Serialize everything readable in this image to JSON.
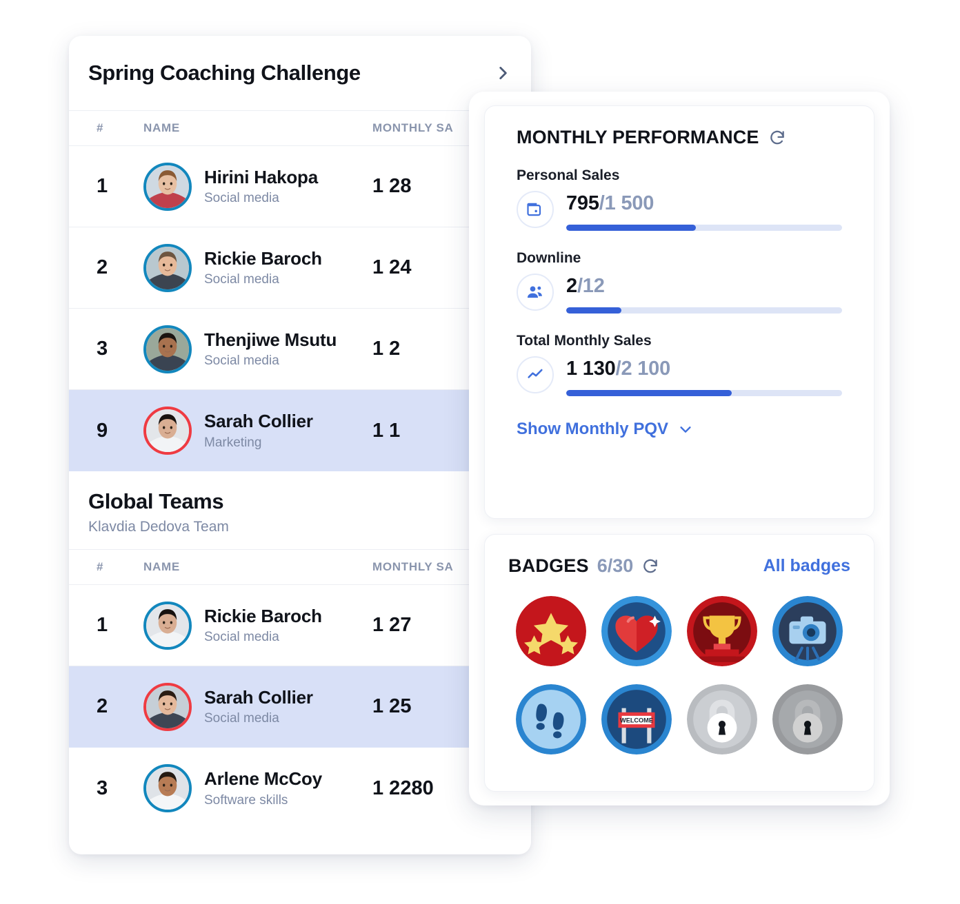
{
  "leaderboard": {
    "title": "Spring Coaching Challenge",
    "next_icon": "chevron-right-icon",
    "columns": {
      "rank": "#",
      "name": "NAME",
      "sales": "MONTHLY SA"
    },
    "rows": [
      {
        "rank": "1",
        "name": "Hirini Hakopa",
        "role": "Social media",
        "sales": "1 28",
        "highlighted": false,
        "ring": "blue"
      },
      {
        "rank": "2",
        "name": "Rickie Baroch",
        "role": "Social media",
        "sales": "1 24",
        "highlighted": false,
        "ring": "blue"
      },
      {
        "rank": "3",
        "name": "Thenjiwe Msutu",
        "role": "Social media",
        "sales": "1 2",
        "highlighted": false,
        "ring": "blue"
      },
      {
        "rank": "9",
        "name": "Sarah Collier",
        "role": "Marketing",
        "sales": "1 1",
        "highlighted": true,
        "ring": "red"
      }
    ]
  },
  "teams": {
    "title": "Global Teams",
    "subtitle": "Klavdia Dedova Team",
    "columns": {
      "rank": "#",
      "name": "NAME",
      "sales": "MONTHLY SA"
    },
    "rows": [
      {
        "rank": "1",
        "name": "Rickie Baroch",
        "role": "Social media",
        "sales": "1 27",
        "highlighted": false,
        "ring": "blue"
      },
      {
        "rank": "2",
        "name": "Sarah Collier",
        "role": "Social media",
        "sales": "1 25",
        "highlighted": true,
        "ring": "red"
      },
      {
        "rank": "3",
        "name": "Arlene McCoy",
        "role": "Software skills",
        "sales": "1 2280",
        "highlighted": false,
        "ring": "blue"
      }
    ]
  },
  "performance": {
    "title": "MONTHLY PERFORMANCE",
    "refresh_icon": "refresh-icon",
    "metrics": [
      {
        "label": "Personal Sales",
        "icon": "wallet-icon",
        "current": "795",
        "separator": "/",
        "target": "1 500",
        "percent": 47
      },
      {
        "label": "Downline",
        "icon": "people-icon",
        "current": "2",
        "separator": "/",
        "target": "12",
        "percent": 20
      },
      {
        "label": "Total Monthly Sales",
        "icon": "trend-line-icon",
        "current": "1 130",
        "separator": "/",
        "target": "2 100",
        "percent": 60
      }
    ],
    "pqv_link": "Show Monthly PQV",
    "pqv_icon": "chevron-down-icon"
  },
  "badges": {
    "title": "BADGES",
    "count": "6/30",
    "refresh_icon": "refresh-icon",
    "all_link": "All badges",
    "items": [
      {
        "name": "stars-badge",
        "locked": false
      },
      {
        "name": "heart-badge",
        "locked": false
      },
      {
        "name": "trophy-badge",
        "locked": false
      },
      {
        "name": "camera-badge",
        "locked": false
      },
      {
        "name": "footsteps-badge",
        "locked": false
      },
      {
        "name": "welcome-sign-badge",
        "locked": false
      },
      {
        "name": "locked-badge",
        "locked": true
      },
      {
        "name": "locked-badge",
        "locked": true
      }
    ]
  },
  "colors": {
    "accent_blue": "#3560d8",
    "link_blue": "#4070dd",
    "highlight_row": "#d8e0f7",
    "ring_blue": "#1287bd",
    "ring_red": "#ef3b42",
    "muted_text": "#7d89a4"
  }
}
